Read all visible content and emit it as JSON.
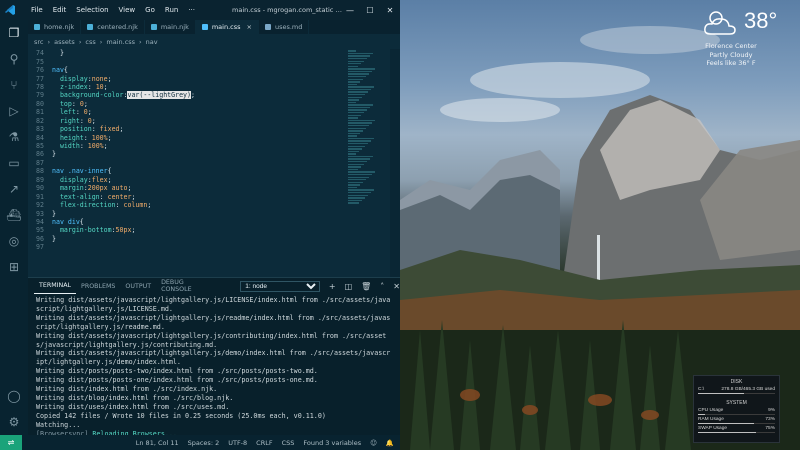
{
  "titlebar": {
    "menu": [
      "File",
      "Edit",
      "Selection",
      "View",
      "Go",
      "Run",
      "···"
    ],
    "title": "main.css - mgrogan.com_static - Visual Stu..."
  },
  "tabs": [
    {
      "label": "home.njk",
      "color": "#4cb0d8",
      "active": false
    },
    {
      "label": "centered.njk",
      "color": "#4cb0d8",
      "active": false
    },
    {
      "label": "main.njk",
      "color": "#4cb0d8",
      "active": false
    },
    {
      "label": "main.css",
      "color": "#4fc1ff",
      "active": true
    },
    {
      "label": "uses.md",
      "color": "#7aa7c7",
      "active": false
    }
  ],
  "breadcrumb": [
    "src",
    "›",
    "assets",
    "›",
    "css",
    "›",
    "main.css",
    "›",
    "nav"
  ],
  "editor": {
    "lines": [
      {
        "n": "74",
        "html": "  }"
      },
      {
        "n": "75",
        "html": ""
      },
      {
        "n": "76",
        "html": "<span class=\"kw\">nav</span>{"
      },
      {
        "n": "77",
        "html": "  <span class=\"pr\">display</span>:<span class=\"vl\">none</span>;"
      },
      {
        "n": "78",
        "html": "  <span class=\"pr\">z-index</span>: <span class=\"vl\">10</span>;"
      },
      {
        "n": "79",
        "html": "  <span class=\"pr\">background-color</span>:<span class=\"hl\">var(--lightGrey)</span>;"
      },
      {
        "n": "80",
        "html": "  <span class=\"pr\">top</span>: <span class=\"vl\">0</span>;"
      },
      {
        "n": "81",
        "html": "  <span class=\"pr\">left</span>: <span class=\"vl\">0</span>;"
      },
      {
        "n": "82",
        "html": "  <span class=\"pr\">right</span>: <span class=\"vl\">0</span>;"
      },
      {
        "n": "83",
        "html": "  <span class=\"pr\">position</span>: <span class=\"vl\">fixed</span>;"
      },
      {
        "n": "84",
        "html": "  <span class=\"pr\">height</span>: <span class=\"vl\">100%</span>;"
      },
      {
        "n": "85",
        "html": "  <span class=\"pr\">width</span>: <span class=\"vl\">100%</span>;"
      },
      {
        "n": "86",
        "html": "}"
      },
      {
        "n": "87",
        "html": ""
      },
      {
        "n": "88",
        "html": "<span class=\"kw\">nav .nav-inner</span>{"
      },
      {
        "n": "89",
        "html": "  <span class=\"pr\">display</span>:<span class=\"vl\">flex</span>;"
      },
      {
        "n": "90",
        "html": "  <span class=\"pr\">margin</span>:<span class=\"vl\">200px auto</span>;"
      },
      {
        "n": "91",
        "html": "  <span class=\"pr\">text-align</span>: <span class=\"vl\">center</span>;"
      },
      {
        "n": "92",
        "html": "  <span class=\"pr\">flex-direction</span>: <span class=\"vl\">column</span>;"
      },
      {
        "n": "93",
        "html": "}"
      },
      {
        "n": "94",
        "html": "<span class=\"kw\">nav div</span>{"
      },
      {
        "n": "95",
        "html": "  <span class=\"pr\">margin-bottom</span>:<span class=\"vl\">50px</span>;"
      },
      {
        "n": "96",
        "html": "}"
      },
      {
        "n": "97",
        "html": ""
      }
    ]
  },
  "panel": {
    "tabs": [
      "TERMINAL",
      "PROBLEMS",
      "OUTPUT",
      "DEBUG CONSOLE"
    ],
    "active_tab": "TERMINAL",
    "terminal_select": "1: node",
    "terminal_lines": [
      "Writing dist/assets/javascript/lightgallery.js/LICENSE/index.html from ./src/assets/javascript/lightgallery.js/LICENSE.md.",
      "Writing dist/assets/javascript/lightgallery.js/readme/index.html from ./src/assets/javascript/lightgallery.js/readme.md.",
      "Writing dist/assets/javascript/lightgallery.js/contributing/index.html from ./src/assets/javascript/lightgallery.js/contributing.md.",
      "Writing dist/assets/javascript/lightgallery.js/demo/index.html from ./src/assets/javascript/lightgallery.js/demo/index.html.",
      "Writing dist/posts/posts-two/index.html from ./src/posts/posts-two.md.",
      "Writing dist/posts/posts-one/index.html from ./src/posts/posts-one.md.",
      "Writing dist/index.html from ./src/index.njk.",
      "Writing dist/blog/index.html from ./src/blog.njk.",
      "Writing dist/uses/index.html from ./src/uses.md.",
      "Copied 142 files / Wrote 10 files in 0.25 seconds (25.0ms each, v0.11.0)",
      "Watching..."
    ],
    "browsersync_tag": "[Browsersync]",
    "browsersync_msg": " Reloading Browsers...",
    "cursor": "[]"
  },
  "status": {
    "position": "Ln 81, Col 11",
    "spaces": "Spaces: 2",
    "encoding": "UTF-8",
    "eol": "CRLF",
    "language": "CSS",
    "variables": "Found 3 variables"
  },
  "weather": {
    "temp": "38°",
    "location": "Florence Center",
    "condition": "Partly Cloudy",
    "feels": "Feels like 36° F"
  },
  "sysmon": {
    "disk_title": "DISK",
    "disk_label": "C:\\",
    "disk_value": "278.8 GB/465.3 GB used",
    "disk_fraction": 0.6,
    "system_title": "SYSTEM",
    "rows": [
      {
        "label": "CPU Usage",
        "value": "9%",
        "fraction": 0.09
      },
      {
        "label": "RAM Usage",
        "value": "73%",
        "fraction": 0.73
      },
      {
        "label": "SWAP Usage",
        "value": "75%",
        "fraction": 0.75
      }
    ]
  },
  "colors": {
    "accent": "#1aa37a",
    "editor_bg": "#0c2b3a",
    "keyword": "#4fc1ff",
    "property": "#54d7c4",
    "value": "#f3ad6a"
  }
}
